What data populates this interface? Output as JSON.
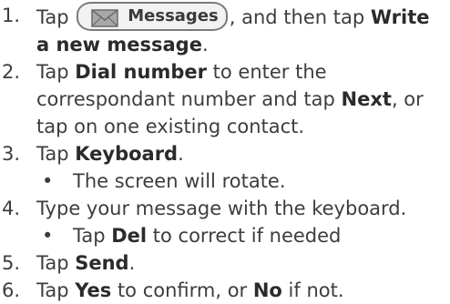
{
  "steps": [
    {
      "number": "1.",
      "pre": "Tap ",
      "button_label": "Messages",
      "mid": ", and then tap ",
      "bold1": "Write",
      "bold2": "a new message",
      "post": "."
    },
    {
      "number": "2.",
      "pre": "Tap ",
      "bold1": "Dial number",
      "line1_rest": " to enter the",
      "line2_pre": "correspondant number and tap ",
      "bold2": "Next",
      "line2_rest": ", or",
      "line3": "tap on one existing contact."
    },
    {
      "number": "3.",
      "pre": "Tap ",
      "bold1": "Keyboard",
      "post": ".",
      "sub": {
        "bullet": "•",
        "text": "The screen will rotate."
      }
    },
    {
      "number": "4.",
      "text": "Type your message with the keyboard.",
      "sub": {
        "bullet": "•",
        "pre": "Tap ",
        "bold": "Del",
        "post": " to correct if needed"
      }
    },
    {
      "number": "5.",
      "pre": "Tap ",
      "bold1": "Send",
      "post": "."
    },
    {
      "number": "6.",
      "pre": "Tap ",
      "bold1": "Yes",
      "mid": " to confirm, or ",
      "bold2": "No",
      "post": " if not."
    }
  ],
  "icons": {
    "messages_button_icon": "envelope-icon"
  }
}
